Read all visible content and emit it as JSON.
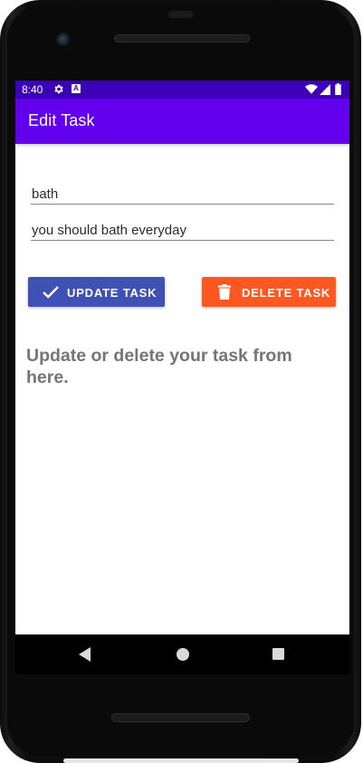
{
  "status_bar": {
    "time": "8:40",
    "icons": [
      "settings-icon",
      "a-notification-icon",
      "wifi-icon",
      "signal-icon",
      "battery-icon"
    ],
    "a_glyph": "A",
    "color": "#3c00b8"
  },
  "app_bar": {
    "title": "Edit Task",
    "color": "#6200ee"
  },
  "form": {
    "title_value": "bath",
    "description_value": "you should bath everyday"
  },
  "buttons": {
    "update": {
      "label": "UPDATE TASK",
      "icon": "check-icon",
      "color": "#3f51b5"
    },
    "delete": {
      "label": "DELETE TASK",
      "icon": "trash-icon",
      "color": "#ff5722"
    }
  },
  "hint_text": "Update or delete your task from here.",
  "nav_bar": {
    "buttons": [
      "back-icon",
      "home-icon",
      "recents-icon"
    ]
  }
}
